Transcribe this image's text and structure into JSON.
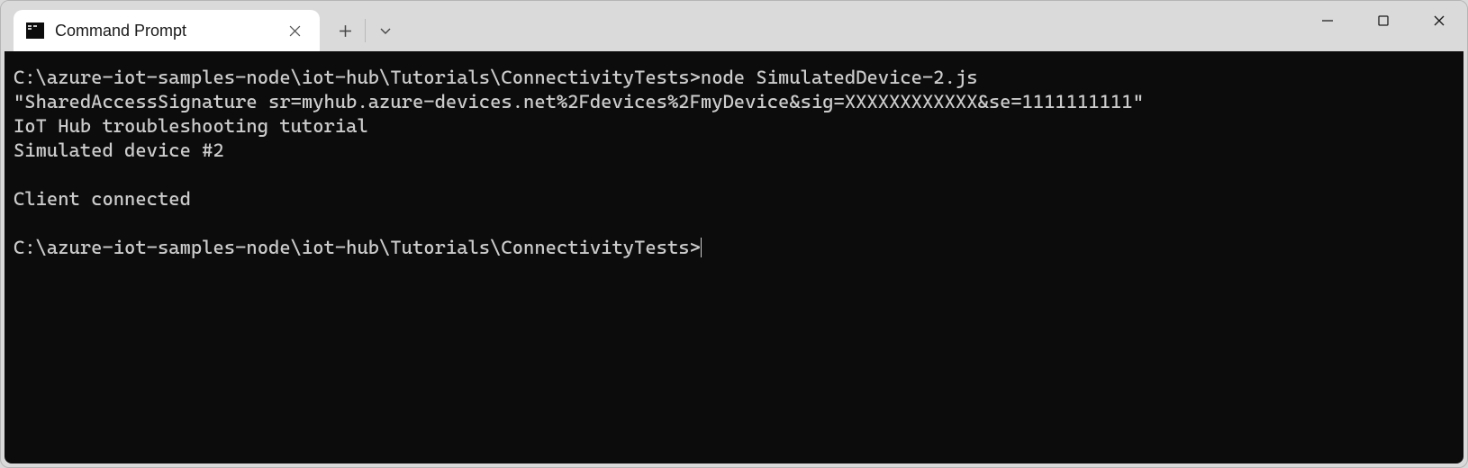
{
  "tab": {
    "title": "Command Prompt"
  },
  "terminal": {
    "line1_prompt": "C:\\azure-iot-samples-node\\iot-hub\\Tutorials\\ConnectivityTests>",
    "line1_cmd": "node SimulatedDevice-2.js",
    "line2": "\"SharedAccessSignature sr=myhub.azure-devices.net%2Fdevices%2FmyDevice&sig=XXXXXXXXXXXX&se=1111111111\"",
    "line3": "IoT Hub troubleshooting tutorial",
    "line4": "Simulated device #2",
    "line5": "",
    "line6": "Client connected",
    "line7": "",
    "line8_prompt": "C:\\azure-iot-samples-node\\iot-hub\\Tutorials\\ConnectivityTests>"
  }
}
